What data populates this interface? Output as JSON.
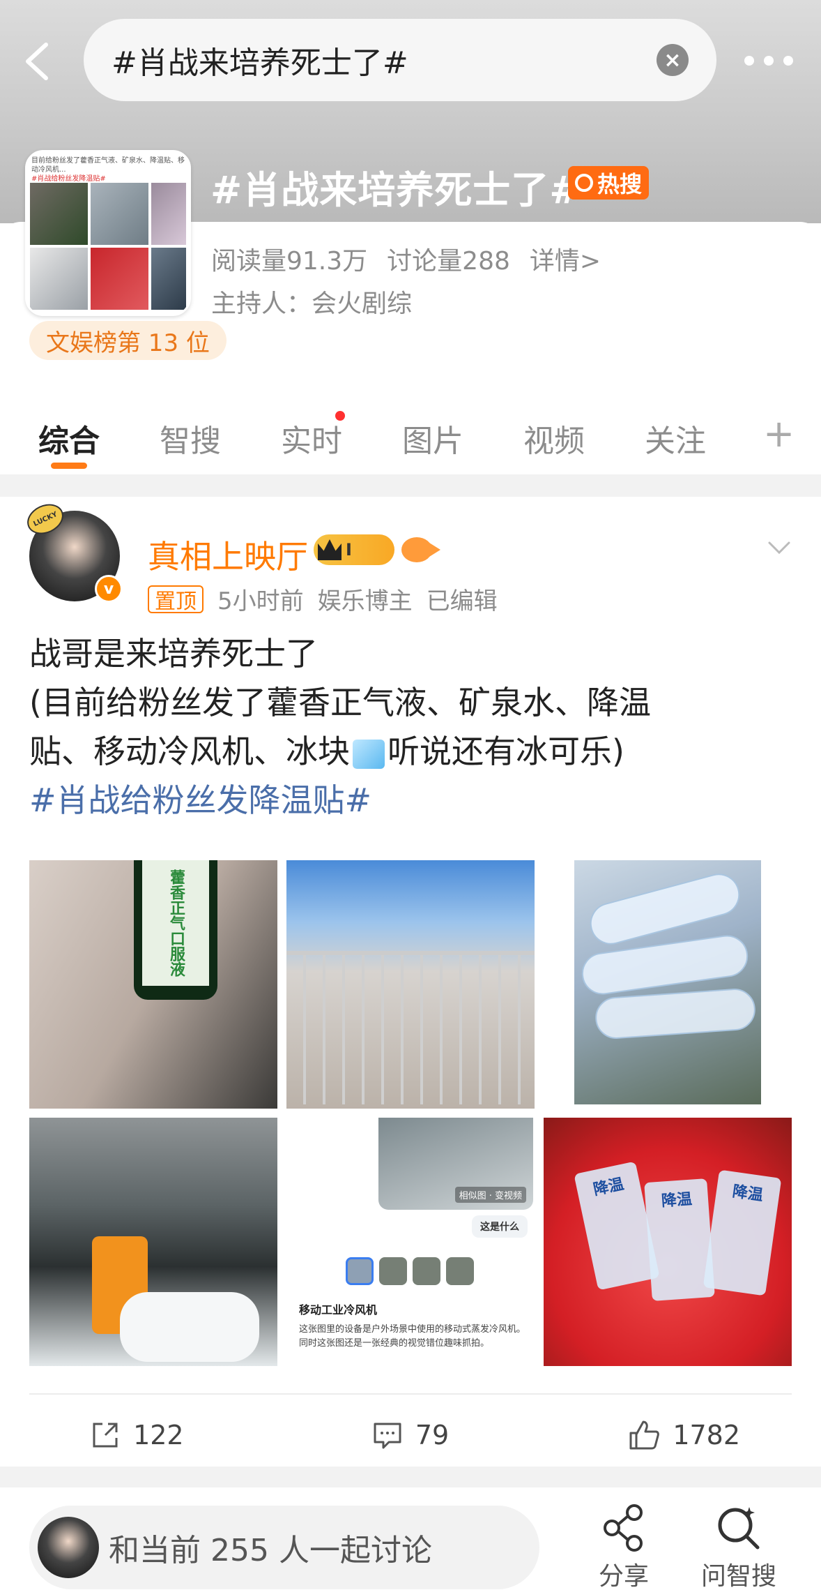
{
  "search": {
    "query": "#肖战来培养死士了#"
  },
  "topic": {
    "title": "#肖战来培养死士了#",
    "hot_badge": "热搜",
    "reads": "阅读量91.3万",
    "discussions": "讨论量288",
    "detail_link": "详情>",
    "host": "主持人：会火剧综",
    "rank": "文娱榜第 13 位",
    "thumb_caption": "目前给粉丝发了藿香正气液、矿泉水、降温贴、移动冷风机...",
    "thumb_tag": "#肖战给粉丝发降温贴#"
  },
  "tabs": [
    {
      "label": "综合"
    },
    {
      "label": "智搜"
    },
    {
      "label": "实时"
    },
    {
      "label": "图片"
    },
    {
      "label": "视频"
    },
    {
      "label": "关注"
    }
  ],
  "tab_plus": "+",
  "post": {
    "username": "真相上映厅",
    "crown_level": "I",
    "pinned_label": "置顶",
    "time": "5小时前",
    "role": "娱乐博主",
    "edited": "已编辑",
    "avatar_badge": "LUCKY",
    "verified": "v",
    "lines": {
      "l1": "战哥是来培养死士了",
      "l2": "(目前给粉丝发了藿香正气液、矿泉水、降温",
      "l3a": "贴、移动冷风机、冰块",
      "l3b": "听说还有冰可乐)",
      "hashtag": "#肖战给粉丝发降温贴#"
    },
    "images": {
      "img1_label": "藿香正气口服液",
      "img5_caption": "相似图 · 变视频",
      "img5_question": "这是什么",
      "img5_heading": "移动工业冷风机",
      "img5_text": "这张图里的设备是户外场景中使用的移动式蒸发冷风机。同时这张图还是一张经典的视觉错位趣味抓拍。",
      "img6_pack": "降温"
    },
    "actions": {
      "share_count": "122",
      "comment_count": "79",
      "like_count": "1782"
    }
  },
  "bottom": {
    "discuss_text": "和当前 255 人一起讨论",
    "share_label": "分享",
    "ask_label": "问智搜"
  },
  "colors": {
    "accent": "#ff7a00",
    "hot_badge": "#ff6b12",
    "hashtag": "#4a6ea9",
    "tab_underline": "#ff7b16"
  }
}
